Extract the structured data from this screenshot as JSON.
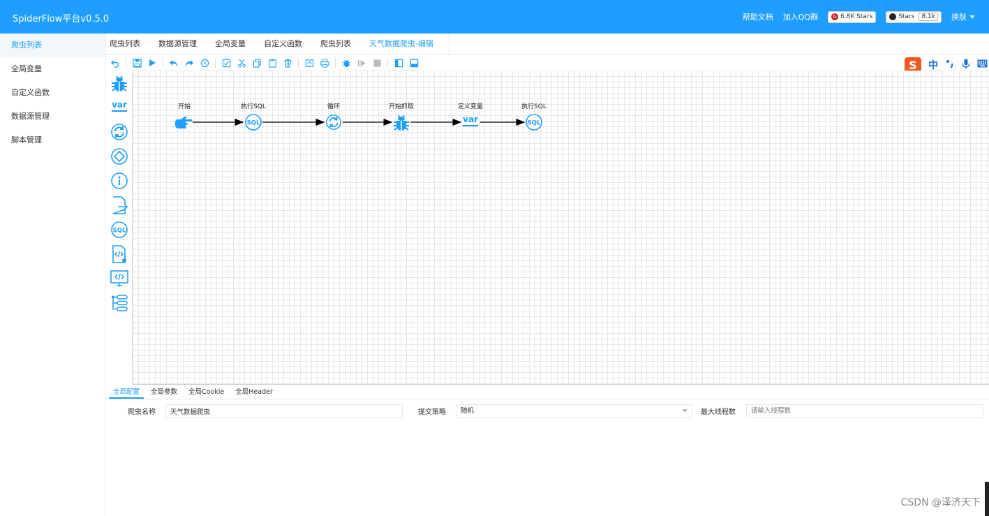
{
  "app": {
    "title": "SpiderFlow平台v0.5.0"
  },
  "header": {
    "help": "帮助文档",
    "qq": "加入QQ群",
    "gitee_stars": "6.8K Stars",
    "github_label": "Stars",
    "github_count": "8.1k",
    "skin": "换肤"
  },
  "sidebar": {
    "items": [
      {
        "label": "爬虫列表",
        "active": true
      },
      {
        "label": "全局变量"
      },
      {
        "label": "自定义函数"
      },
      {
        "label": "数据源管理"
      },
      {
        "label": "脚本管理"
      }
    ]
  },
  "tabs": [
    "爬虫列表",
    "数据源管理",
    "全局变量",
    "自定义函数",
    "爬虫列表",
    "天气数据爬虫-编辑"
  ],
  "ime": {
    "zh": "中"
  },
  "flow": {
    "nodes": [
      {
        "label": "开始",
        "icon": "hand-pointer-icon"
      },
      {
        "label": "执行SQL",
        "icon": "sql-icon"
      },
      {
        "label": "循环",
        "icon": "loop-icon"
      },
      {
        "label": "开始抓取",
        "icon": "spider-icon"
      },
      {
        "label": "定义变量",
        "icon": "var-icon"
      },
      {
        "label": "执行SQL",
        "icon": "sql-icon"
      }
    ]
  },
  "palette": {
    "var_text": "var",
    "sql_text": "SQL"
  },
  "bottom": {
    "tabs": [
      "全局配置",
      "全局参数",
      "全局Cookie",
      "全局Header"
    ],
    "form": {
      "name_label": "爬虫名称",
      "name_value": "天气数据爬虫",
      "strategy_label": "提交策略",
      "strategy_value": "随机",
      "threads_label": "最大线程数",
      "threads_placeholder": "请输入线程数"
    }
  },
  "watermark": "CSDN @泽济天下",
  "colors": {
    "primary": "#1e9fff",
    "ime_orange": "#f25a22"
  }
}
